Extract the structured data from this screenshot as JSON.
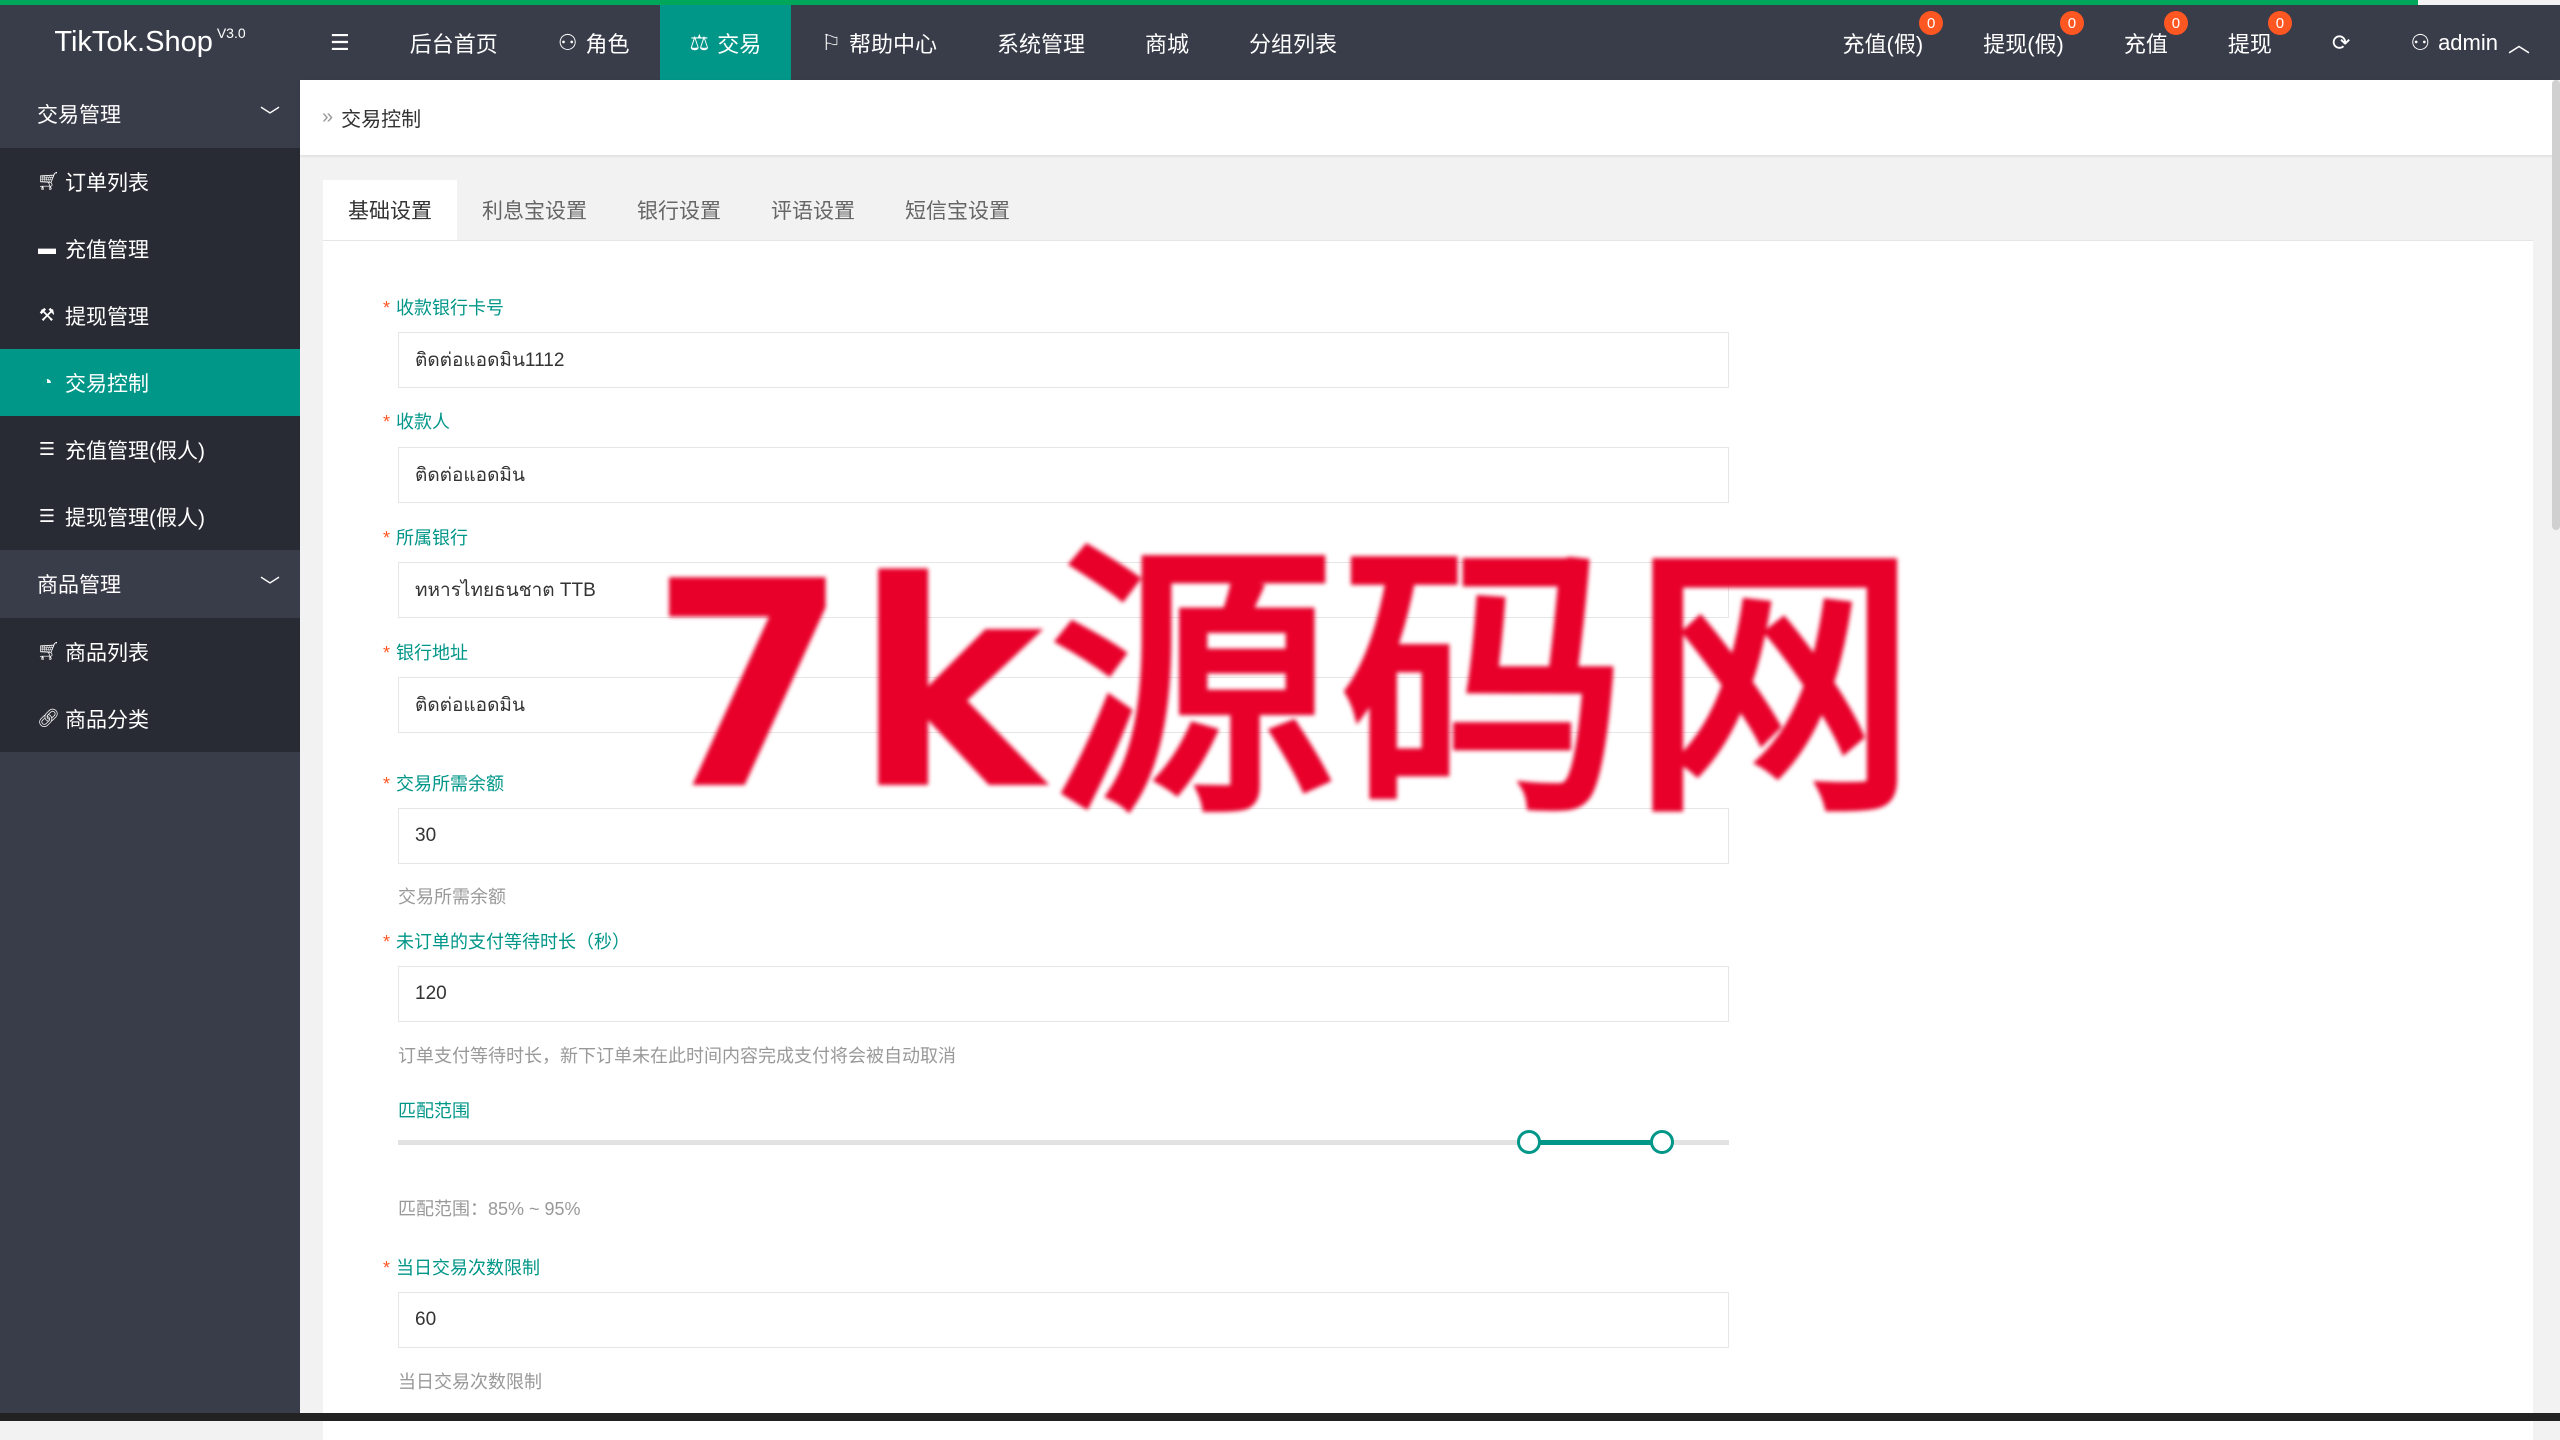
{
  "app": {
    "logo": "TikTok.Shop",
    "version": "V3.0",
    "user": "admin"
  },
  "topnav": [
    {
      "label": "后台首页",
      "icon": "",
      "active": false
    },
    {
      "label": "角色",
      "icon": "user-icon",
      "active": false
    },
    {
      "label": "交易",
      "icon": "scale-icon",
      "active": true
    },
    {
      "label": "帮助中心",
      "icon": "flag-icon",
      "active": false
    },
    {
      "label": "系统管理",
      "icon": "",
      "active": false
    },
    {
      "label": "商城",
      "icon": "",
      "active": false
    },
    {
      "label": "分组列表",
      "icon": "",
      "active": false
    }
  ],
  "rightnav": [
    {
      "label": "充值(假)",
      "badge": "0"
    },
    {
      "label": "提现(假)",
      "badge": "0"
    },
    {
      "label": "充值",
      "badge": "0"
    },
    {
      "label": "提现",
      "badge": "0"
    }
  ],
  "sidebar": {
    "group1": {
      "label": "交易管理"
    },
    "group1_items": [
      {
        "label": "订单列表",
        "icon": "cart-icon"
      },
      {
        "label": "充值管理",
        "icon": "screen-icon"
      },
      {
        "label": "提现管理",
        "icon": "gavel-icon"
      },
      {
        "label": "交易控制",
        "icon": "dashboard-icon",
        "active": true
      },
      {
        "label": "充值管理(假人)",
        "icon": "list-icon"
      },
      {
        "label": "提现管理(假人)",
        "icon": "list-icon"
      }
    ],
    "group2": {
      "label": "商品管理"
    },
    "group2_items": [
      {
        "label": "商品列表",
        "icon": "cart-icon"
      },
      {
        "label": "商品分类",
        "icon": "link-icon"
      }
    ]
  },
  "breadcrumb": "交易控制",
  "tabs": [
    "基础设置",
    "利息宝设置",
    "银行设置",
    "评语设置",
    "短信宝设置"
  ],
  "form": {
    "bank_card_label": "收款银行卡号",
    "bank_card_value": "ติดต่อแอดมิน1112",
    "payee_label": "收款人",
    "payee_value": "ติดต่อแอดมิน",
    "bank_label": "所属银行",
    "bank_value": "ทหารไทยธนชาต TTB",
    "bank_addr_label": "银行地址",
    "bank_addr_value": "ติดต่อแอดมิน",
    "balance_label": "交易所需余额",
    "balance_value": "30",
    "balance_hint": "交易所需余额",
    "wait_label": "未订单的支付等待时长（秒）",
    "wait_value": "120",
    "wait_hint": "订单支付等待时长，新下订单未在此时间内容完成支付将会被自动取消",
    "range_label": "匹配范围",
    "range_hint": "匹配范围：85% ~ 95%",
    "range_min": 85,
    "range_max": 95,
    "daily_label": "当日交易次数限制",
    "daily_value": "60",
    "daily_hint": "当日交易次数限制"
  },
  "watermark": "7k源码网",
  "colors": {
    "accent": "#009688",
    "badge": "#ff5722",
    "dark": "#393d49"
  }
}
